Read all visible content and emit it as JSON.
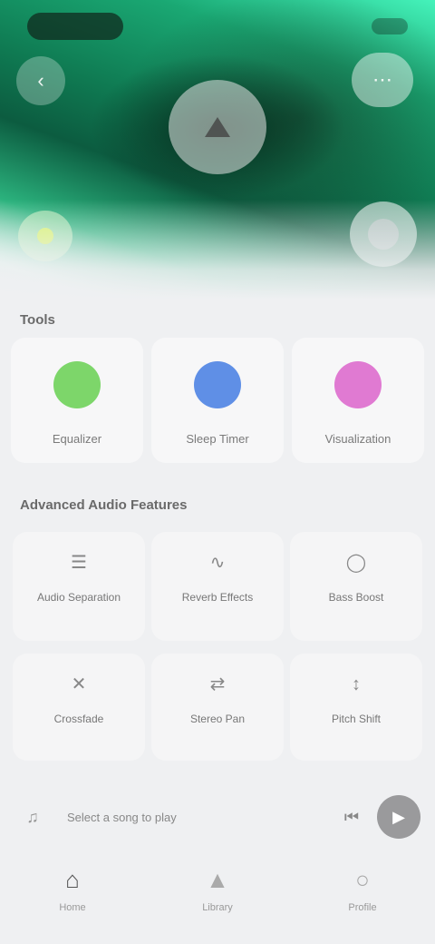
{
  "hero": {
    "back_icon": "chevron-left-icon",
    "more_icon": "more-icon",
    "play_icon": "play-icon",
    "tag_icon": "tag-icon",
    "fab_icon": "add-icon"
  },
  "quick": {
    "title": "Tools",
    "items": [
      {
        "label": "Equalizer",
        "color": "#7dd66a"
      },
      {
        "label": "Sleep Timer",
        "color": "#5f8fe6"
      },
      {
        "label": "Visualization",
        "color": "#e07ad2"
      }
    ]
  },
  "features": {
    "title": "Advanced Audio Features",
    "items": [
      {
        "label": "Audio Separation",
        "icon": "layers-icon"
      },
      {
        "label": "Reverb Effects",
        "icon": "wave-icon"
      },
      {
        "label": "Bass Boost",
        "icon": "speaker-icon"
      },
      {
        "label": "Crossfade",
        "icon": "crossfade-icon"
      },
      {
        "label": "Stereo Pan",
        "icon": "pan-icon"
      },
      {
        "label": "Pitch Shift",
        "icon": "pitch-icon"
      }
    ]
  },
  "player": {
    "title": "Select a song to play",
    "prev_icon": "previous-icon",
    "play_icon": "play-icon"
  },
  "tabs": [
    {
      "label": "Home",
      "icon": "home-icon"
    },
    {
      "label": "Library",
      "icon": "library-icon"
    },
    {
      "label": "Profile",
      "icon": "profile-icon"
    }
  ]
}
